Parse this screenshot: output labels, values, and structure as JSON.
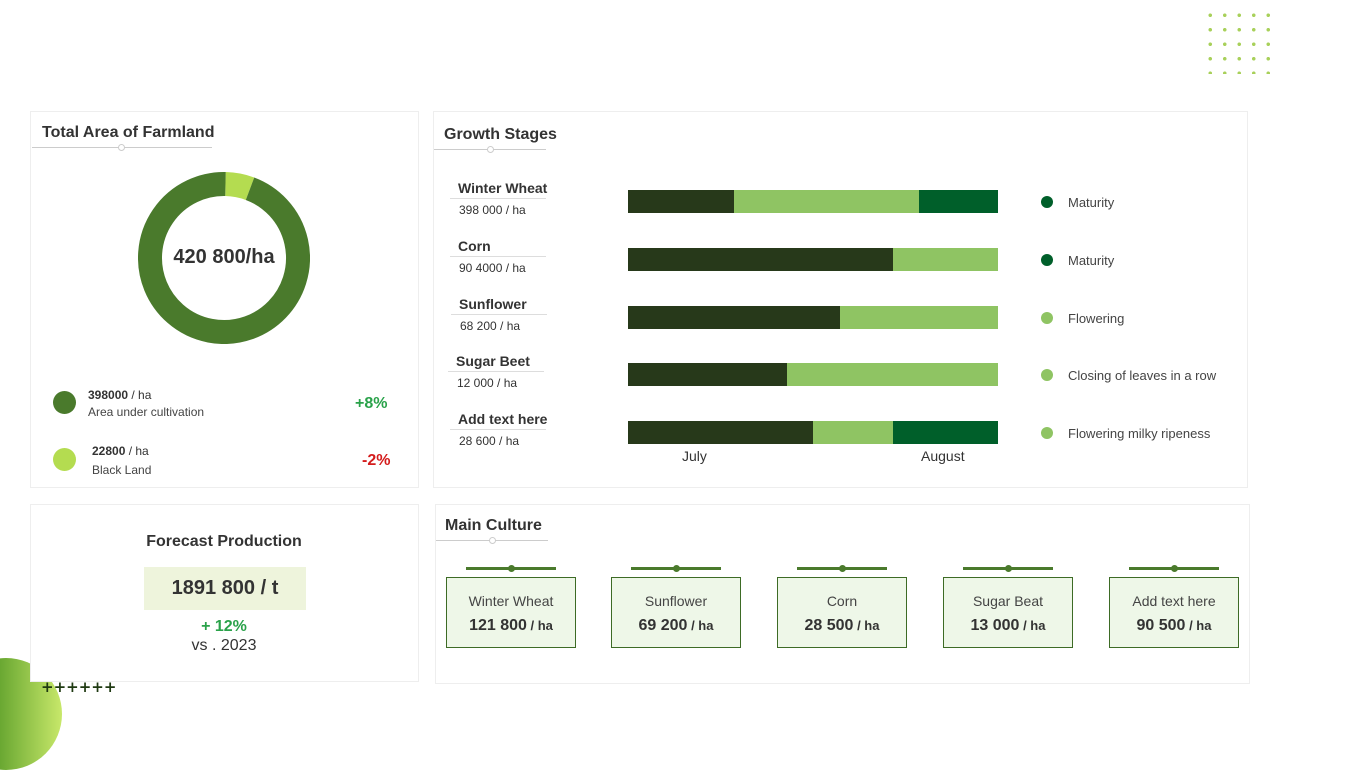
{
  "colors": {
    "dark_green": "#27391a",
    "light_green": "#8fc463",
    "deep_green": "#005f2a",
    "olive": "#4a7a2c",
    "lime": "#b4dc50",
    "positive": "#2aa24a",
    "negative": "#d41c1c"
  },
  "farmland": {
    "title": "Total Area of Farmland",
    "total_label": "420 800/ha",
    "items": [
      {
        "value": "398000",
        "unit": " / ha",
        "desc": "Area under cultivation",
        "pct": "+8%",
        "share": 0.946,
        "color": "#4a7a2c"
      },
      {
        "value": "22800",
        "unit": " / ha",
        "desc": "Black Land",
        "pct": "-2%",
        "share": 0.054,
        "color": "#b4dc50"
      }
    ]
  },
  "growth": {
    "title": "Growth Stages",
    "axis": [
      "July",
      "August"
    ],
    "rows": [
      {
        "name": "Winter Wheat",
        "value": "398 000  / ha",
        "stage": "Maturity",
        "stage_color": "#005f2a",
        "segments": [
          0.286,
          0.5,
          0.214
        ]
      },
      {
        "name": "Corn",
        "value": "90 4000  / ha",
        "stage": "Maturity",
        "stage_color": "#005f2a",
        "segments": [
          0.716,
          0.284,
          0
        ]
      },
      {
        "name": "Sunflower",
        "value": "68 200  / ha",
        "stage": "Flowering",
        "stage_color": "#8fc463",
        "segments": [
          0.573,
          0.427,
          0
        ]
      },
      {
        "name": "Sugar Beet",
        "value": "12 000  / ha",
        "stage": "Closing of leaves  in a row",
        "stage_color": "#8fc463",
        "segments": [
          0.43,
          0.57,
          0
        ]
      },
      {
        "name": "Add text here",
        "value": "28 600  / ha",
        "stage": "Flowering  milky ripeness",
        "stage_color": "#8fc463",
        "segments": [
          0.5,
          0.216,
          0.284
        ]
      }
    ]
  },
  "forecast": {
    "title": "Forecast Production",
    "value": "1891 800 / t",
    "change": "+ 12%",
    "compare": "vs . 2023"
  },
  "culture": {
    "title": "Main Culture",
    "items": [
      {
        "name": "Winter Wheat",
        "value": "121 800",
        "unit": " / ha"
      },
      {
        "name": "Sunflower",
        "value": "69 200",
        "unit": " / ha"
      },
      {
        "name": "Corn",
        "value": "28 500",
        "unit": " / ha"
      },
      {
        "name": "Sugar Beat",
        "value": "13 000",
        "unit": " / ha"
      },
      {
        "name": "Add text here",
        "value": "90 500",
        "unit": " / ha"
      }
    ]
  },
  "decor": {
    "plus_row": "++++++"
  }
}
